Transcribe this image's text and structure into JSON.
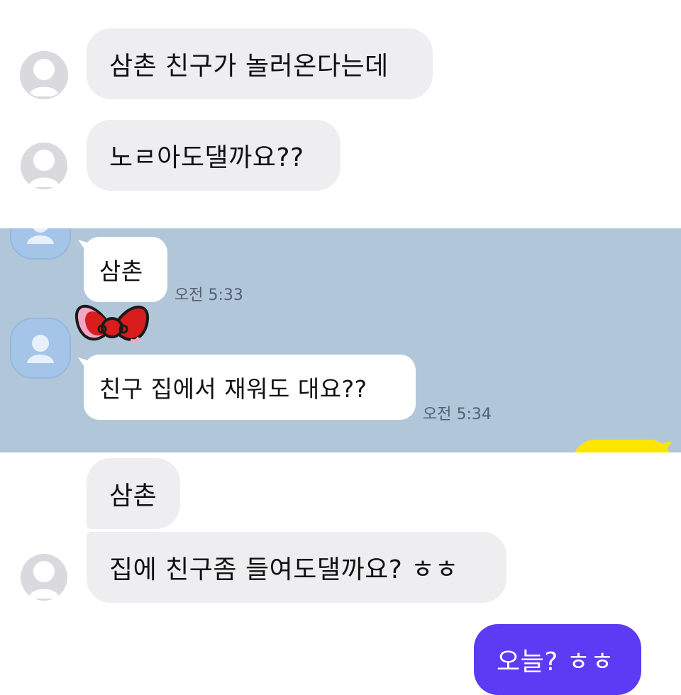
{
  "top_messages": [
    {
      "text": "삼촌 친구가 놀러온다는데"
    },
    {
      "text": "노ㄹ아도댈까요??"
    }
  ],
  "kakao_messages": [
    {
      "text": "삼촌",
      "time": "오전 5:33"
    },
    {
      "text": "친구 집에서 재워도 대요??",
      "time": "오전 5:34"
    }
  ],
  "bottom_messages": [
    {
      "text": "삼촌"
    },
    {
      "text": "집에 친구좀 들여도댈까요? ㅎㅎ"
    }
  ],
  "my_message": {
    "text": "오늘? ㅎㅎ"
  },
  "colors": {
    "gray_bubble": "#eeeef0",
    "kakao_background": "#b1c6d9",
    "kakao_my_bubble": "#fee500",
    "my_bubble": "#5b3cf4",
    "bow": "#d91d1d"
  }
}
